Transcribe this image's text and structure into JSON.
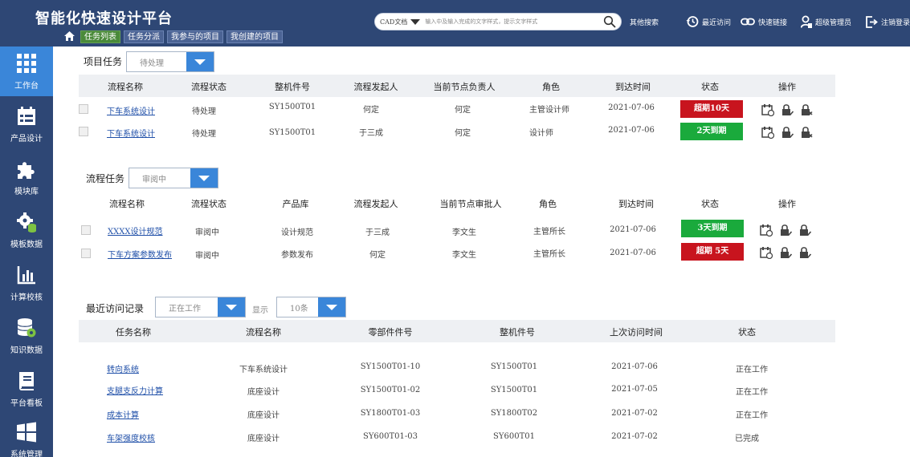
{
  "header": {
    "title": "智能化快速设计平台",
    "tabs": [
      {
        "label": "任务列表",
        "active": true
      },
      {
        "label": "任务分派",
        "active": false
      },
      {
        "label": "我参与的项目",
        "active": false
      },
      {
        "label": "我创建的项目",
        "active": false
      }
    ],
    "search": {
      "type_label": "CAD文档",
      "placeholder": "输入中及输入完成的文字样式，提示文字样式"
    },
    "other_search": "其他搜索",
    "recent_visit": "最近访问",
    "quick_link": "快速链接",
    "user": "超级管理员",
    "logout": "注销登录"
  },
  "sidebar": {
    "items": [
      {
        "label": "工作台",
        "icon": "grid-icon",
        "active": true
      },
      {
        "label": "产品设计",
        "icon": "calendar-icon",
        "active": false
      },
      {
        "label": "模块库",
        "icon": "puzzle-icon",
        "active": false
      },
      {
        "label": "模板数据",
        "icon": "gear-database-icon",
        "active": false
      },
      {
        "label": "计算校核",
        "icon": "bar-chart-icon",
        "active": false
      },
      {
        "label": "知识数据",
        "icon": "database-gear-icon",
        "active": false
      },
      {
        "label": "平台看板",
        "icon": "book-icon",
        "active": false
      },
      {
        "label": "系统管理",
        "icon": "windows-icon",
        "active": false
      }
    ]
  },
  "project_tasks": {
    "title": "项目任务",
    "filter": "待处理",
    "columns": [
      "流程名称",
      "流程状态",
      "整机件号",
      "流程发起人",
      "当前节点负责人",
      "角色",
      "到达时间",
      "状态",
      "操作"
    ],
    "rows": [
      {
        "name": "下车系统设计",
        "status": "待处理",
        "part_no": "SY1500T01",
        "initiator": "何定",
        "owner": "何定",
        "role": "主管设计师",
        "arrival": "2021-07-06",
        "badge": "超期10天",
        "badge_color": "#c8141e"
      },
      {
        "name": "下车系统设计",
        "status": "待处理",
        "part_no": "SY1500T01",
        "initiator": "于三成",
        "owner": "何定",
        "role": "设计师",
        "arrival": "2021-07-06",
        "badge": "2天到期",
        "badge_color": "#1aaa3c"
      }
    ]
  },
  "flow_tasks": {
    "title": "流程任务",
    "filter": "审阅中",
    "columns": [
      "流程名称",
      "流程状态",
      "产品库",
      "流程发起人",
      "当前节点审批人",
      "角色",
      "到达时间",
      "状态",
      "操作"
    ],
    "rows": [
      {
        "name": "XXXX设计规范",
        "status": "审阅中",
        "library": "设计规范",
        "initiator": "于三成",
        "approver": "李文生",
        "role": "主管所长",
        "arrival": "2021-07-06",
        "badge": "3天到期",
        "badge_color": "#1aaa3c"
      },
      {
        "name": "下车方案参数发布",
        "status": "审阅中",
        "library": "参数发布",
        "initiator": "何定",
        "approver": "李文生",
        "role": "主管所长",
        "arrival": "2021-07-06",
        "badge": "超期 5天",
        "badge_color": "#c8141e"
      }
    ]
  },
  "recent": {
    "title": "最近访问记录",
    "filter": "正在工作",
    "show_label": "显示",
    "page_size": "10条",
    "columns": [
      "任务名称",
      "流程名称",
      "零部件件号",
      "整机件号",
      "上次访问时间",
      "状态"
    ],
    "rows": [
      {
        "task": "转向系统",
        "flow": "下车系统设计",
        "part": "SY1500T01-10",
        "machine": "SY1500T01",
        "time": "2021-07-06",
        "state": "正在工作"
      },
      {
        "task": "支腿支反力计算",
        "flow": "底座设计",
        "part": "SY1500T01-02",
        "machine": "SY1500T01",
        "time": "2021-07-05",
        "state": "正在工作"
      },
      {
        "task": "成本计算",
        "flow": "底座设计",
        "part": "SY1800T01-03",
        "machine": "SY1800T02",
        "time": "2021-07-02",
        "state": "正在工作"
      },
      {
        "task": "车架强度校核",
        "flow": "底座设计",
        "part": "SY600T01-03",
        "machine": "SY600T01",
        "time": "2021-07-02",
        "state": "已完成"
      }
    ]
  }
}
